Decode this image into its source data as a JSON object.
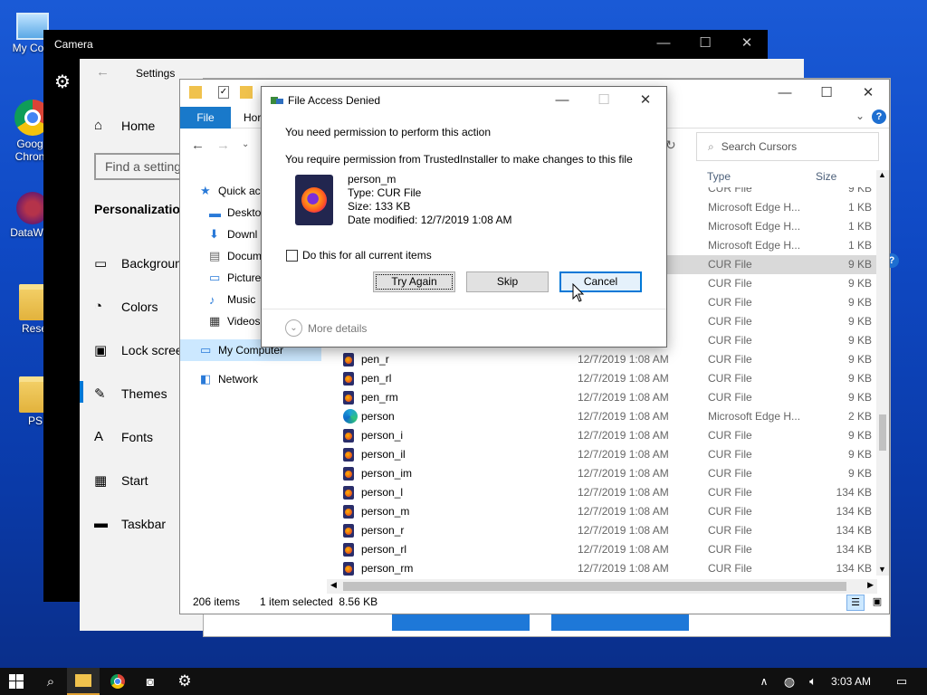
{
  "desktop": {
    "icons": [
      {
        "label": "My Com"
      },
      {
        "label": "Goog Chron"
      },
      {
        "label": "DataWag"
      },
      {
        "label": "Rese"
      },
      {
        "label": "PS"
      }
    ]
  },
  "camera": {
    "title": "Camera",
    "minimize": "—",
    "maximize": "☐",
    "close": "✕"
  },
  "settings": {
    "title": "Settings",
    "home": "Home",
    "search_placeholder": "Find a setting",
    "section": "Personalization",
    "items": [
      "Background",
      "Colors",
      "Lock screen",
      "Themes",
      "Fonts",
      "Start",
      "Taskbar"
    ]
  },
  "explorer": {
    "tab_file": "File",
    "tab_home": "Hor",
    "search_placeholder": "Search Cursors",
    "col_type": "Type",
    "col_size": "Size",
    "nav": {
      "quick_access": "Quick ac",
      "desktop": "Deskto",
      "downloads": "Downl",
      "documents": "Docum",
      "pictures": "Picture",
      "music": "Music",
      "videos": "Videos",
      "my_computer": "My Computer",
      "network": "Network"
    },
    "partial_rows": [
      {
        "type": "CUR File",
        "size": "9 KB"
      },
      {
        "type": "Microsoft Edge H...",
        "size": "1 KB"
      },
      {
        "type": "Microsoft Edge H...",
        "size": "1 KB"
      },
      {
        "type": "Microsoft Edge H...",
        "size": "1 KB"
      },
      {
        "type": "CUR File",
        "size": "9 KB"
      },
      {
        "type": "CUR File",
        "size": "9 KB"
      },
      {
        "type": "CUR File",
        "size": "9 KB"
      },
      {
        "type": "CUR File",
        "size": "9 KB"
      },
      {
        "type": "CUR File",
        "size": "9 KB"
      }
    ],
    "rows": [
      {
        "name": "pen_r",
        "date": "12/7/2019 1:08 AM",
        "type": "CUR File",
        "size": "9 KB",
        "icon": "cur"
      },
      {
        "name": "pen_rl",
        "date": "12/7/2019 1:08 AM",
        "type": "CUR File",
        "size": "9 KB",
        "icon": "cur"
      },
      {
        "name": "pen_rm",
        "date": "12/7/2019 1:08 AM",
        "type": "CUR File",
        "size": "9 KB",
        "icon": "cur"
      },
      {
        "name": "person",
        "date": "12/7/2019 1:08 AM",
        "type": "Microsoft Edge H...",
        "size": "2 KB",
        "icon": "edge"
      },
      {
        "name": "person_i",
        "date": "12/7/2019 1:08 AM",
        "type": "CUR File",
        "size": "9 KB",
        "icon": "cur"
      },
      {
        "name": "person_il",
        "date": "12/7/2019 1:08 AM",
        "type": "CUR File",
        "size": "9 KB",
        "icon": "cur"
      },
      {
        "name": "person_im",
        "date": "12/7/2019 1:08 AM",
        "type": "CUR File",
        "size": "9 KB",
        "icon": "cur"
      },
      {
        "name": "person_l",
        "date": "12/7/2019 1:08 AM",
        "type": "CUR File",
        "size": "134 KB",
        "icon": "cur"
      },
      {
        "name": "person_m",
        "date": "12/7/2019 1:08 AM",
        "type": "CUR File",
        "size": "134 KB",
        "icon": "cur"
      },
      {
        "name": "person_r",
        "date": "12/7/2019 1:08 AM",
        "type": "CUR File",
        "size": "134 KB",
        "icon": "cur"
      },
      {
        "name": "person_rl",
        "date": "12/7/2019 1:08 AM",
        "type": "CUR File",
        "size": "134 KB",
        "icon": "cur"
      },
      {
        "name": "person_rm",
        "date": "12/7/2019 1:08 AM",
        "type": "CUR File",
        "size": "134 KB",
        "icon": "cur"
      }
    ],
    "status": {
      "items": "206 items",
      "selected": "1 item selected  8.56 KB"
    }
  },
  "dialog": {
    "title": "File Access Denied",
    "heading": "You need permission to perform this action",
    "message": "You require permission from TrustedInstaller to make changes to this file",
    "file_name": "person_m",
    "file_type": "Type: CUR File",
    "file_size": "Size: 133 KB",
    "file_modified": "Date modified: 12/7/2019 1:08 AM",
    "checkbox_label": "Do this for all current items",
    "try_again": "Try Again",
    "skip": "Skip",
    "cancel": "Cancel",
    "more_details": "More details"
  },
  "taskbar": {
    "time": "3:03 AM"
  },
  "colors": {
    "accent": "#0078d7",
    "file_tab": "#1979ca",
    "taskbar": "#101010"
  }
}
